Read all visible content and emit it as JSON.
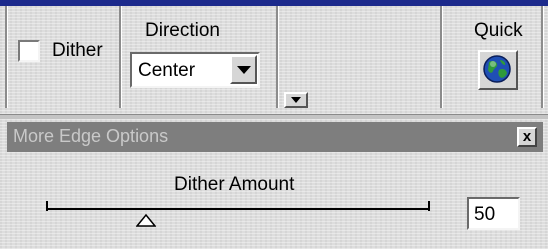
{
  "toolbar": {
    "dither_label": "Dither",
    "dither_checked": false,
    "direction_label": "Direction",
    "direction_value": "Center",
    "quick_label": "Quick"
  },
  "edge_panel": {
    "title": "More Edge Options",
    "close_label": "x",
    "dither_amount_label": "Dither Amount",
    "dither_amount_value": "50",
    "slider_fraction": 0.26
  },
  "icons": {
    "dropdown": "chevron-down-icon",
    "globe": "globe-icon",
    "close": "close-icon",
    "thumb": "slider-thumb-icon"
  },
  "colors": {
    "title_bar": "#7e7e7e",
    "top_accent": "#1c2a8c",
    "background": "#dcdcdc"
  }
}
